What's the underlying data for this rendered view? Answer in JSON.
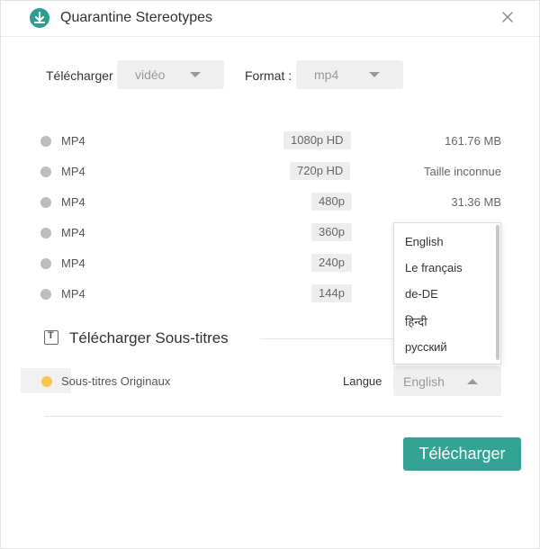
{
  "window": {
    "title": "Quarantine Stereotypes"
  },
  "options": {
    "download_label": "Télécharger",
    "type_value": "vidéo",
    "format_label": "Format :",
    "format_value": "mp4"
  },
  "formats": [
    {
      "format": "MP4",
      "quality": "1080p HD",
      "size": "161.76 MB"
    },
    {
      "format": "MP4",
      "quality": "720p HD",
      "size": "Taille inconnue"
    },
    {
      "format": "MP4",
      "quality": "480p",
      "size": "31.36 MB"
    },
    {
      "format": "MP4",
      "quality": "360p",
      "size": ""
    },
    {
      "format": "MP4",
      "quality": "240p",
      "size": ""
    },
    {
      "format": "MP4",
      "quality": "144p",
      "size": ""
    }
  ],
  "subtitles": {
    "heading": "Télécharger Sous-titres",
    "icon_letter": "T",
    "original_label": "Sous-titres Originaux",
    "language_label": "Langue",
    "language_value": "English",
    "language_options": [
      "English",
      "Le français",
      "de-DE",
      "हिन्दी",
      "русский"
    ]
  },
  "actions": {
    "download_button": "Télécharger"
  },
  "colors": {
    "accent": "#33a395",
    "radio_selected": "#f9c54d",
    "radio_unselected": "#bdbdbd"
  }
}
